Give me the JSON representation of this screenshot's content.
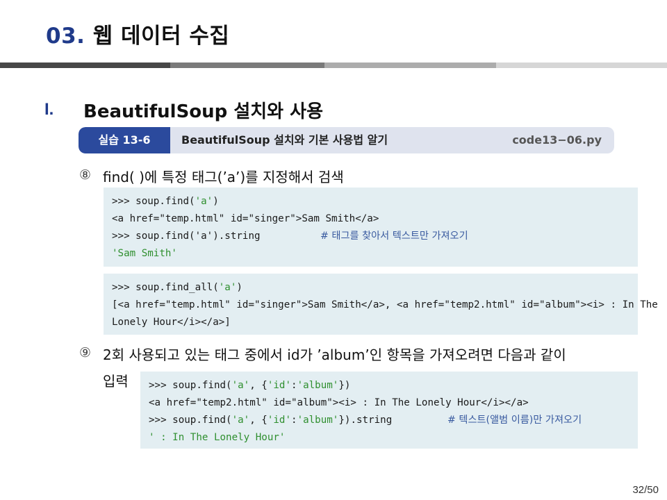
{
  "header": {
    "num": "03.",
    "title": "웹 데이터 수집"
  },
  "section": {
    "num": "I.",
    "title": "BeautifulSoup 설치와 사용"
  },
  "banner": {
    "tag": "실습 13-6",
    "text": "BeautifulSoup 설치와 기본 사용법 알기",
    "code": "code13−06.py"
  },
  "steps": [
    {
      "num": "⑧",
      "text": "find( )에 특정 태그(’a’)를 지정해서 검색"
    },
    {
      "num": "⑨",
      "text": "2회 사용되고 있는 태그 중에서 id가 ’album’인 항목을 가져오려면 다음과 같이",
      "text2": "입력"
    }
  ],
  "code1": {
    "l1_a": ">>> soup.find(",
    "l1_s": "'a'",
    "l1_b": ")",
    "l2": "<a href=\"temp.html\" id=\"singer\">Sam Smith</a>",
    "l3_a": ">>> soup.find('a').string",
    "l3_c": "# 태그를 찾아서 텍스트만 가져오기",
    "l4": "'Sam Smith'"
  },
  "code2": {
    "l1_a": ">>> soup.find_all(",
    "l1_s": "'a'",
    "l1_b": ")",
    "l2": "[<a href=\"temp.html\" id=\"singer\">Sam Smith</a>, <a href=\"temp2.html\" id=\"album\"><i> : In The",
    "l3": "Lonely Hour</i></a>]"
  },
  "code3": {
    "l1_a": ">>> soup.find(",
    "l1_s1": "'a'",
    "l1_m": ", {",
    "l1_s2": "'id'",
    "l1_c": ":",
    "l1_s3": "'album'",
    "l1_b": "})",
    "l2": "<a href=\"temp2.html\" id=\"album\"><i> : In The Lonely Hour</i></a>",
    "l3_a": ">>> soup.find(",
    "l3_s1": "'a'",
    "l3_m": ", {",
    "l3_s2": "'id'",
    "l3_c": ":",
    "l3_s3": "'album'",
    "l3_b": "}).string",
    "l3_cmt": "# 텍스트(앨범 이름)만 가져오기",
    "l4": "' : In The Lonely Hour'"
  },
  "footer": {
    "page": "32/50"
  }
}
